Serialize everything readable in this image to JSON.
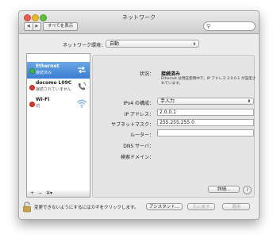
{
  "window": {
    "title": "ネットワーク",
    "nav_back": "◀",
    "nav_fwd": "▶",
    "show_all": "すべてを表示",
    "search_placeholder": ""
  },
  "location": {
    "label": "ネットワーク環境：",
    "value": "自動"
  },
  "services": [
    {
      "name": "Ethernet",
      "status": "接続済み",
      "dot": "green",
      "icon": "ethernet-arrows-icon",
      "selected": true
    },
    {
      "name": "docomo L09C",
      "status": "接続されていません",
      "dot": "red",
      "icon": "phone-modem-icon",
      "selected": false
    },
    {
      "name": "Wi-Fi",
      "status": "切",
      "dot": "red",
      "icon": "wifi-icon",
      "selected": false
    }
  ],
  "sidebar_controls": {
    "add": "+",
    "remove": "−",
    "gear": "✲▾"
  },
  "detail": {
    "status_label": "状況：",
    "status_value": "接続済み",
    "status_note": "Ethernet は現在使用中で、IP アドレス 2.0.0.1 が設定されています。",
    "ipv4_label": "IPv4 の構成：",
    "ipv4_value": "手入力",
    "ip_label": "IP アドレス：",
    "ip_value": "2.0.0.1",
    "subnet_label": "サブネットマスク：",
    "subnet_value": "255.255.255.0",
    "router_label": "ルーター：",
    "router_value": "",
    "dns_label": "DNS サーバ：",
    "domain_label": "検索ドメイン：",
    "advanced_button": "詳細...",
    "help_button": "?"
  },
  "footer": {
    "lock_text": "変更できないようにするにはカギをクリックします。",
    "assistant_button": "アシスタント...",
    "revert_button": "元に戻す",
    "apply_button": "適用"
  },
  "colors": {
    "selection": "#3a7dd2",
    "connected": "#3fb54a",
    "disconnected": "#d83a2e"
  }
}
